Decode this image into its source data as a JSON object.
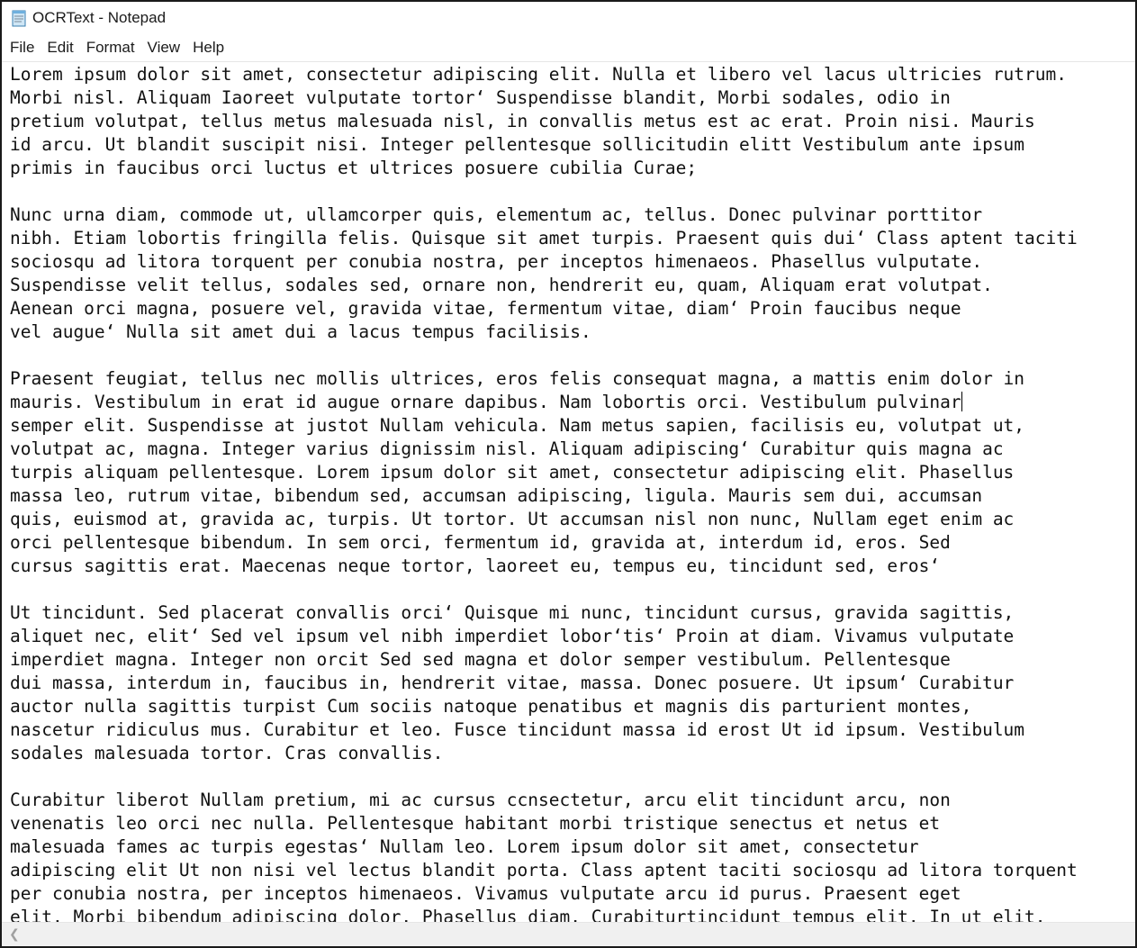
{
  "window": {
    "title": "OCRText - Notepad"
  },
  "menu": [
    {
      "label": "File"
    },
    {
      "label": "Edit"
    },
    {
      "label": "Format"
    },
    {
      "label": "View"
    },
    {
      "label": "Help"
    }
  ],
  "editor": {
    "lines": [
      "Lorem ipsum dolor sit amet, consectetur adipiscing elit. Nulla et libero vel lacus ultricies rutrum.",
      "Morbi nisl. Aliquam Iaoreet vulputate tortor‘ Suspendisse blandit, Morbi sodales, odio in",
      "pretium volutpat, tellus metus malesuada nisl, in convallis metus est ac erat. Proin nisi. Mauris",
      "id arcu. Ut blandit suscipit nisi. Integer pellentesque sollicitudin elitt Vestibulum ante ipsum",
      "primis in faucibus orci luctus et ultrices posuere cubilia Curae;",
      "",
      "Nunc urna diam, commode ut, ullamcorper quis, elementum ac, tellus. Donec pulvinar porttitor",
      "nibh. Etiam lobortis fringilla felis. Quisque sit amet turpis. Praesent quis dui‘ Class aptent taciti",
      "sociosqu ad litora torquent per conubia nostra, per inceptos himenaeos. Phasellus vulputate.",
      "Suspendisse velit tellus, sodales sed, ornare non, hendrerit eu, quam, Aliquam erat volutpat.",
      "Aenean orci magna, posuere vel, gravida vitae, fermentum vitae, diam‘ Proin faucibus neque",
      "vel augue‘ Nulla sit amet dui a lacus tempus facilisis.",
      "",
      "Praesent feugiat, tellus nec mollis ultrices, eros felis consequat magna, a mattis enim dolor in",
      "mauris. Vestibulum in erat id augue ornare dapibus. Nam lobortis orci. Vestibulum pulvinar",
      "semper elit. Suspendisse at justot Nullam vehicula. Nam metus sapien, facilisis eu, volutpat ut,",
      "volutpat ac, magna. Integer varius dignissim nisl. Aliquam adipiscing‘ Curabitur quis magna ac",
      "turpis aliquam pellentesque. Lorem ipsum dolor sit amet, consectetur adipiscing elit. Phasellus",
      "massa leo, rutrum vitae, bibendum sed, accumsan adipiscing, ligula. Mauris sem dui, accumsan",
      "quis, euismod at, gravida ac, turpis. Ut tortor. Ut accumsan nisl non nunc, Nullam eget enim ac",
      "orci pellentesque bibendum. In sem orci, fermentum id, gravida at, interdum id, eros. Sed",
      "cursus sagittis erat. Maecenas neque tortor, laoreet eu, tempus eu, tincidunt sed, eros‘",
      "",
      "Ut tincidunt. Sed placerat convallis orci‘ Quisque mi nunc, tincidunt cursus, gravida sagittis,",
      "aliquet nec, elit‘ Sed vel ipsum vel nibh imperdiet lobor‘tis‘ Proin at diam. Vivamus vulputate",
      "imperdiet magna. Integer non orcit Sed sed magna et dolor semper vestibulum. Pellentesque",
      "dui massa, interdum in, faucibus in, hendrerit vitae, massa. Donec posuere. Ut ipsum‘ Curabitur",
      "auctor nulla sagittis turpist Cum sociis natoque penatibus et magnis dis parturient montes,",
      "nascetur ridiculus mus. Curabitur et leo. Fusce tincidunt massa id erost Ut id ipsum. Vestibulum",
      "sodales malesuada tortor. Cras convallis.",
      "",
      "Curabitur liberot Nullam pretium, mi ac cursus ccnsectetur, arcu elit tincidunt arcu, non",
      "venenatis leo orci nec nulla. Pellentesque habitant morbi tristique senectus et netus et",
      "malesuada fames ac turpis egestas‘ Nullam leo. Lorem ipsum dolor sit amet, consectetur",
      "adipiscing elit Ut non nisi vel lectus blandit porta. Class aptent taciti sociosqu ad litora torquent",
      "per conubia nostra, per inceptos himenaeos. Vivamus vulputate arcu id purus. Praesent eget",
      "elit. Morbi bibendum adipiscing dolor. Phasellus diam. Curabiturtincidunt tempus elit. In ut elit."
    ],
    "caret_line": 14
  },
  "icons": {
    "app": "notepad-icon",
    "scroll_left": "scroll-left-arrow-icon"
  }
}
